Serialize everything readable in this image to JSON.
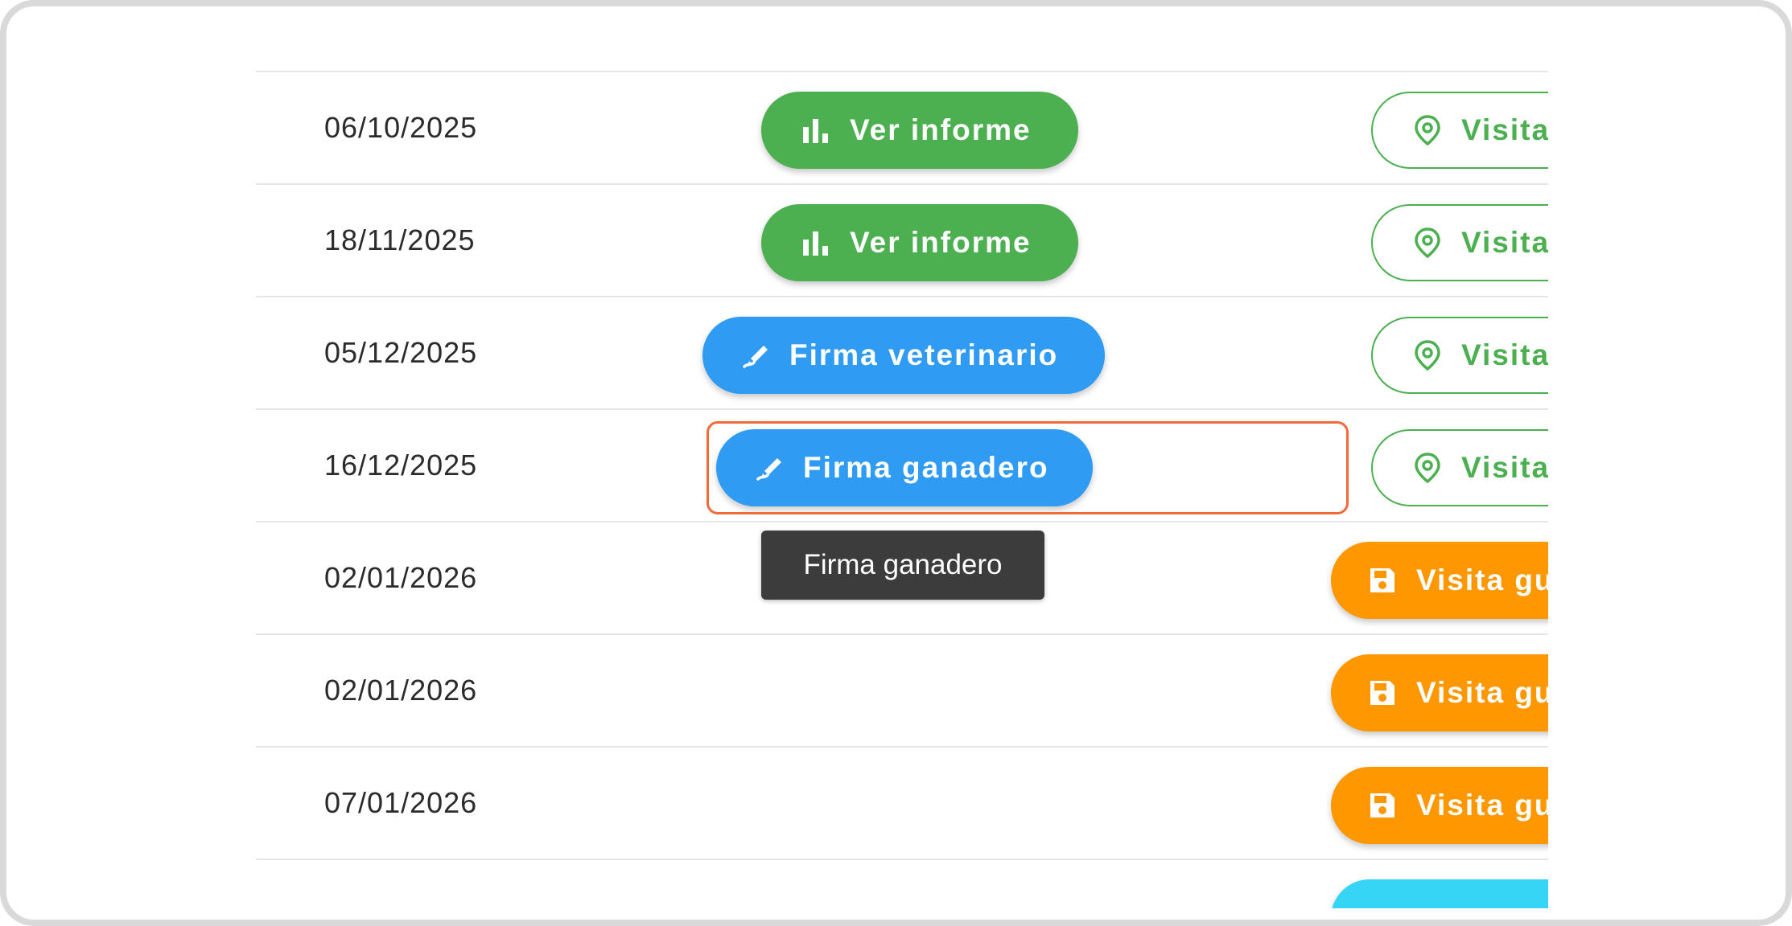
{
  "rows": [
    {
      "date": "06/10/2025",
      "action": "Ver informe",
      "visit": "Visita"
    },
    {
      "date": "18/11/2025",
      "action": "Ver informe",
      "visit": "Visita"
    },
    {
      "date": "05/12/2025",
      "action": "Firma veterinario",
      "visit": "Visita"
    },
    {
      "date": "16/12/2025",
      "action": "Firma ganadero",
      "visit": "Visita"
    },
    {
      "date": "02/01/2026",
      "visit": "Visita gu"
    },
    {
      "date": "02/01/2026",
      "visit": "Visita gu"
    },
    {
      "date": "07/01/2026",
      "visit": "Visita gu"
    }
  ],
  "tooltip": "Firma ganadero",
  "colors": {
    "green": "#4caf50",
    "blue": "#2f9bf3",
    "orange": "#ff9800",
    "cyan": "#36d4f5",
    "highlight": "#f06a3a",
    "tooltip_bg": "#3c3c3c"
  },
  "icons": {
    "report": "bar-chart-icon",
    "sign": "signature-icon",
    "visit_planned": "location-pin-icon",
    "visit_saved": "save-icon"
  }
}
